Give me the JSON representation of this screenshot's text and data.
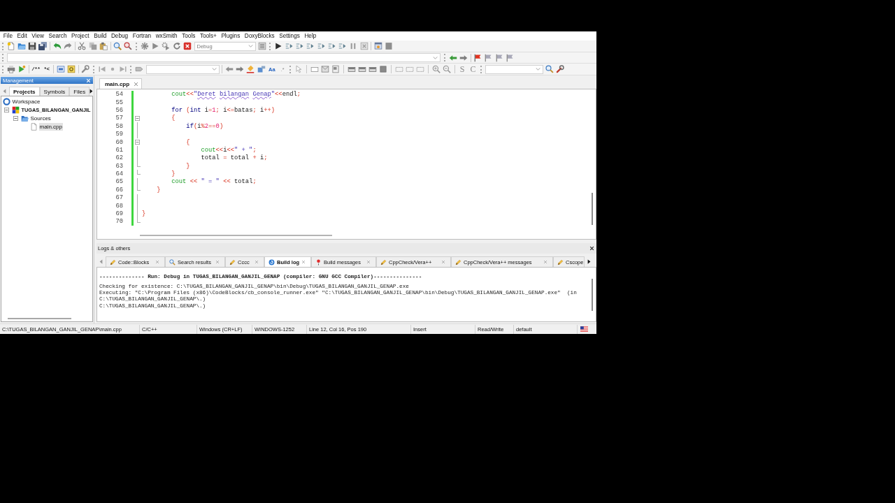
{
  "menu": [
    "File",
    "Edit",
    "View",
    "Search",
    "Project",
    "Build",
    "Debug",
    "Fortran",
    "wxSmith",
    "Tools",
    "Tools+",
    "Plugins",
    "DoxyBlocks",
    "Settings",
    "Help"
  ],
  "toolbar_1": {
    "build_target": "Debug"
  },
  "toolbar_3": {
    "comment_buttons": [
      "/**",
      "*<"
    ],
    "text_buttons": [
      "Aa",
      ".*"
    ],
    "search_buttons": [
      "S",
      "C"
    ]
  },
  "management": {
    "title": "Management",
    "tabs": [
      {
        "label": "Projects",
        "selected": true
      },
      {
        "label": "Symbols",
        "selected": false
      },
      {
        "label": "Files",
        "selected": false
      }
    ],
    "tree": [
      {
        "label": "Workspace",
        "kind": "workspace",
        "selected": false,
        "children": [
          {
            "label": "TUGAS_BILANGAN_GANJIL",
            "kind": "project",
            "expanded": true,
            "selected": false,
            "children": [
              {
                "label": "Sources",
                "kind": "folder",
                "expanded": true,
                "selected": false,
                "children": [
                  {
                    "label": "main.cpp",
                    "kind": "file",
                    "selected": true
                  }
                ]
              }
            ]
          }
        ]
      }
    ]
  },
  "editor": {
    "tabs": [
      {
        "label": "main.cpp",
        "selected": true
      }
    ],
    "lines": [
      {
        "number": "54",
        "changed": true,
        "kind": "plain",
        "tokens": [
          {
            "text": "        cout",
            "kind": "builtin"
          },
          {
            "text": "<<",
            "kind": "op"
          },
          {
            "text": "\"",
            "kind": "string"
          },
          {
            "text": "Deret bilangan Genap",
            "kind": "misspelled"
          },
          {
            "text": "\"",
            "kind": "string"
          },
          {
            "text": "<<",
            "kind": "op"
          },
          {
            "text": "endl",
            "kind": "plain"
          },
          {
            "text": ";",
            "kind": "op"
          }
        ]
      },
      {
        "number": "55",
        "changed": true,
        "kind": "plain"
      },
      {
        "number": "56",
        "changed": true,
        "kind": "plain",
        "tokens": [
          {
            "text": "        for",
            "kind": "keyword"
          },
          {
            "text": " (",
            "kind": "op"
          },
          {
            "text": "int",
            "kind": "keyword"
          },
          {
            "text": " i",
            "kind": "plain"
          },
          {
            "text": "=",
            "kind": "op"
          },
          {
            "text": "1",
            "kind": "number"
          },
          {
            "text": ";",
            "kind": "op"
          },
          {
            "text": " i",
            "kind": "plain"
          },
          {
            "text": "<=",
            "kind": "op"
          },
          {
            "text": "batas",
            "kind": "plain"
          },
          {
            "text": ";",
            "kind": "op"
          },
          {
            "text": " i",
            "kind": "plain"
          },
          {
            "text": "++)",
            "kind": "op"
          }
        ]
      },
      {
        "number": "57",
        "changed": true,
        "kind": "start",
        "tokens": [
          {
            "text": "        {",
            "kind": "op"
          }
        ]
      },
      {
        "number": "58",
        "changed": true,
        "kind": "inside",
        "tokens": [
          {
            "text": "            if",
            "kind": "keyword"
          },
          {
            "text": "(",
            "kind": "op"
          },
          {
            "text": "i",
            "kind": "plain"
          },
          {
            "text": "%",
            "kind": "op"
          },
          {
            "text": "2",
            "kind": "number"
          },
          {
            "text": "==",
            "kind": "op"
          },
          {
            "text": "0",
            "kind": "number"
          },
          {
            "text": ")",
            "kind": "op"
          }
        ]
      },
      {
        "number": "59",
        "changed": true,
        "kind": "inside"
      },
      {
        "number": "60",
        "changed": true,
        "kind": "start",
        "tokens": [
          {
            "text": "            {",
            "kind": "op"
          }
        ]
      },
      {
        "number": "61",
        "changed": true,
        "kind": "inside",
        "tokens": [
          {
            "text": "                cout",
            "kind": "builtin"
          },
          {
            "text": "<<",
            "kind": "op"
          },
          {
            "text": "i",
            "kind": "plain"
          },
          {
            "text": "<<",
            "kind": "op"
          },
          {
            "text": "\" + \"",
            "kind": "string"
          },
          {
            "text": ";",
            "kind": "op"
          }
        ]
      },
      {
        "number": "62",
        "changed": true,
        "kind": "inside",
        "tokens": [
          {
            "text": "                total ",
            "kind": "plain"
          },
          {
            "text": "=",
            "kind": "op"
          },
          {
            "text": " total ",
            "kind": "plain"
          },
          {
            "text": "+",
            "kind": "op"
          },
          {
            "text": " i",
            "kind": "plain"
          },
          {
            "text": ";",
            "kind": "op"
          }
        ]
      },
      {
        "number": "63",
        "changed": true,
        "kind": "end",
        "tokens": [
          {
            "text": "            }",
            "kind": "op"
          }
        ]
      },
      {
        "number": "64",
        "changed": true,
        "kind": "end",
        "tokens": [
          {
            "text": "        }",
            "kind": "op"
          }
        ]
      },
      {
        "number": "65",
        "changed": true,
        "kind": "inside",
        "tokens": [
          {
            "text": "        cout",
            "kind": "builtin"
          },
          {
            "text": " << ",
            "kind": "op"
          },
          {
            "text": "\" = \"",
            "kind": "string"
          },
          {
            "text": " << ",
            "kind": "op"
          },
          {
            "text": "total",
            "kind": "plain"
          },
          {
            "text": ";",
            "kind": "op"
          }
        ]
      },
      {
        "number": "66",
        "changed": true,
        "kind": "end",
        "tokens": [
          {
            "text": "    }",
            "kind": "op"
          }
        ]
      },
      {
        "number": "67",
        "changed": true,
        "kind": "inside"
      },
      {
        "number": "68",
        "changed": true,
        "kind": "inside"
      },
      {
        "number": "69",
        "changed": true,
        "kind": "inside",
        "tokens": [
          {
            "text": "}",
            "kind": "op"
          }
        ]
      },
      {
        "number": "70",
        "changed": true,
        "kind": "end"
      }
    ]
  },
  "logs": {
    "title": "Logs & others",
    "tabs": [
      {
        "label": "Code::Blocks",
        "kind": "plugin",
        "selected": false,
        "closable": true
      },
      {
        "label": "Search results",
        "kind": "search",
        "selected": false,
        "closable": true
      },
      {
        "label": "Cccc",
        "kind": "plugin",
        "selected": false,
        "closable": true
      },
      {
        "label": "Build log",
        "kind": "log",
        "selected": true,
        "closable": true
      },
      {
        "label": "Build messages",
        "kind": "messages",
        "selected": false,
        "closable": true
      },
      {
        "label": "CppCheck/Vera++",
        "kind": "plugin",
        "selected": false,
        "closable": true
      },
      {
        "label": "CppCheck/Vera++ messages",
        "kind": "plugin",
        "selected": false,
        "closable": true
      },
      {
        "label": "Cscope",
        "kind": "plugin",
        "selected": false,
        "closable": false
      }
    ],
    "lines": [
      {
        "text": "-------------- Run: Debug in TUGAS_BILANGAN_GANJIL_GENAP (compiler: GNU GCC Compiler)---------------",
        "kind": "header"
      },
      {
        "text": "Checking for existence: C:\\TUGAS_BILANGAN_GANJIL_GENAP\\bin\\Debug\\TUGAS_BILANGAN_GANJIL_GENAP.exe",
        "kind": "plain"
      },
      {
        "text": "Executing: \"C:\\Program Files (x86)\\CodeBlocks/cb_console_runner.exe\" \"C:\\TUGAS_BILANGAN_GANJIL_GENAP\\bin\\Debug\\TUGAS_BILANGAN_GANJIL_GENAP.exe\"  (in",
        "kind": "plain"
      },
      {
        "text": "C:\\TUGAS_BILANGAN_GANJIL_GENAP\\.)",
        "kind": "plain"
      },
      {
        "text": "C:\\TUGAS_BILANGAN_GANJIL_GENAP\\.)",
        "kind": "plain"
      }
    ]
  },
  "status_bar": [
    "C:\\TUGAS_BILANGAN_GANJIL_GENAP\\main.cpp",
    "C/C++",
    "Windows (CR+LF)",
    "WINDOWS-1252",
    "Line 12, Col 16, Pos 190",
    "Insert",
    "Read/Write",
    "default"
  ]
}
